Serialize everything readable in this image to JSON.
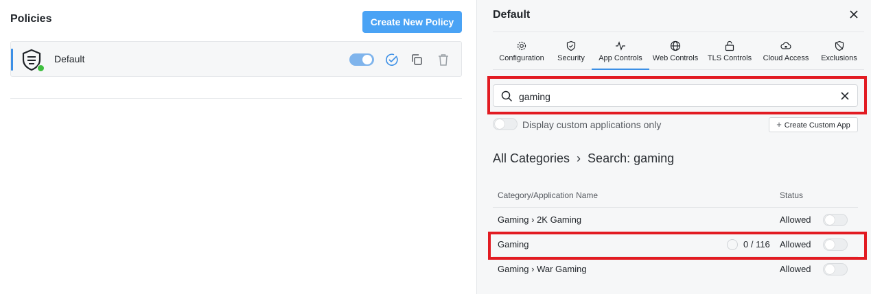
{
  "left": {
    "title": "Policies",
    "create_button": "Create New Policy",
    "policy": {
      "name": "Default",
      "enabled": true
    }
  },
  "right": {
    "title": "Default",
    "tabs": [
      {
        "label": "Configuration",
        "icon": "gear-icon"
      },
      {
        "label": "Security",
        "icon": "shield-check-icon"
      },
      {
        "label": "App Controls",
        "icon": "pulse-icon",
        "active": true
      },
      {
        "label": "Web Controls",
        "icon": "globe-icon"
      },
      {
        "label": "TLS Controls",
        "icon": "unlock-icon"
      },
      {
        "label": "Cloud Access",
        "icon": "cloud-lock-icon"
      },
      {
        "label": "Exclusions",
        "icon": "shield-slash-icon"
      }
    ],
    "search": {
      "value": "gaming"
    },
    "custom_only_label": "Display custom applications only",
    "create_custom_label": "Create Custom App",
    "breadcrumb": "All Categories  ›  Search: gaming",
    "table": {
      "col_name": "Category/Application Name",
      "col_status": "Status",
      "rows": [
        {
          "name": "Gaming › 2K Gaming",
          "status": "Allowed",
          "count": ""
        },
        {
          "name": "Gaming",
          "status": "Allowed",
          "count": "0 / 116"
        },
        {
          "name": "Gaming › War Gaming",
          "status": "Allowed",
          "count": ""
        }
      ]
    }
  },
  "colors": {
    "accent": "#4aa3f5",
    "highlight": "#e21b22",
    "online": "#3fbf3f"
  }
}
